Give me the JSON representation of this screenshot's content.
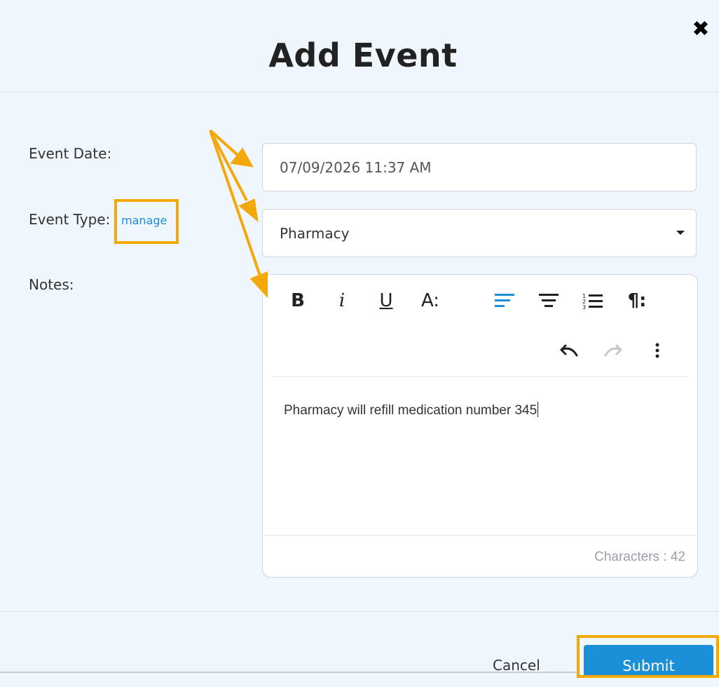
{
  "dialog": {
    "title": "Add Event",
    "close_icon": "close-icon"
  },
  "form": {
    "event_date_label": "Event Date:",
    "event_date_value": "07/09/2026 11:37 AM",
    "event_type_label": "Event Type:",
    "manage_link": "manage",
    "event_type_value": "Pharmacy",
    "notes_label": "Notes:"
  },
  "editor": {
    "toolbar": [
      {
        "name": "bold",
        "glyph": "B"
      },
      {
        "name": "italic",
        "glyph": "i"
      },
      {
        "name": "underline",
        "glyph": "U"
      },
      {
        "name": "font-size",
        "glyph": "A:"
      },
      {
        "name": "align-left",
        "icon": "align-left-icon"
      },
      {
        "name": "align-center",
        "icon": "align-center-icon"
      },
      {
        "name": "ordered-list",
        "icon": "ordered-list-icon"
      },
      {
        "name": "paragraph",
        "glyph": "¶:"
      },
      {
        "name": "undo",
        "icon": "undo-icon"
      },
      {
        "name": "redo",
        "icon": "redo-icon"
      },
      {
        "name": "more",
        "icon": "more-vertical-icon"
      }
    ],
    "content": "Pharmacy will refill medication number 345",
    "char_count": "Characters : 42"
  },
  "actions": {
    "cancel_label": "Cancel",
    "submit_label": "Submit"
  },
  "colors": {
    "accent": "#1b8fd8",
    "highlight": "#f4a90b",
    "background": "#eff6fd"
  }
}
